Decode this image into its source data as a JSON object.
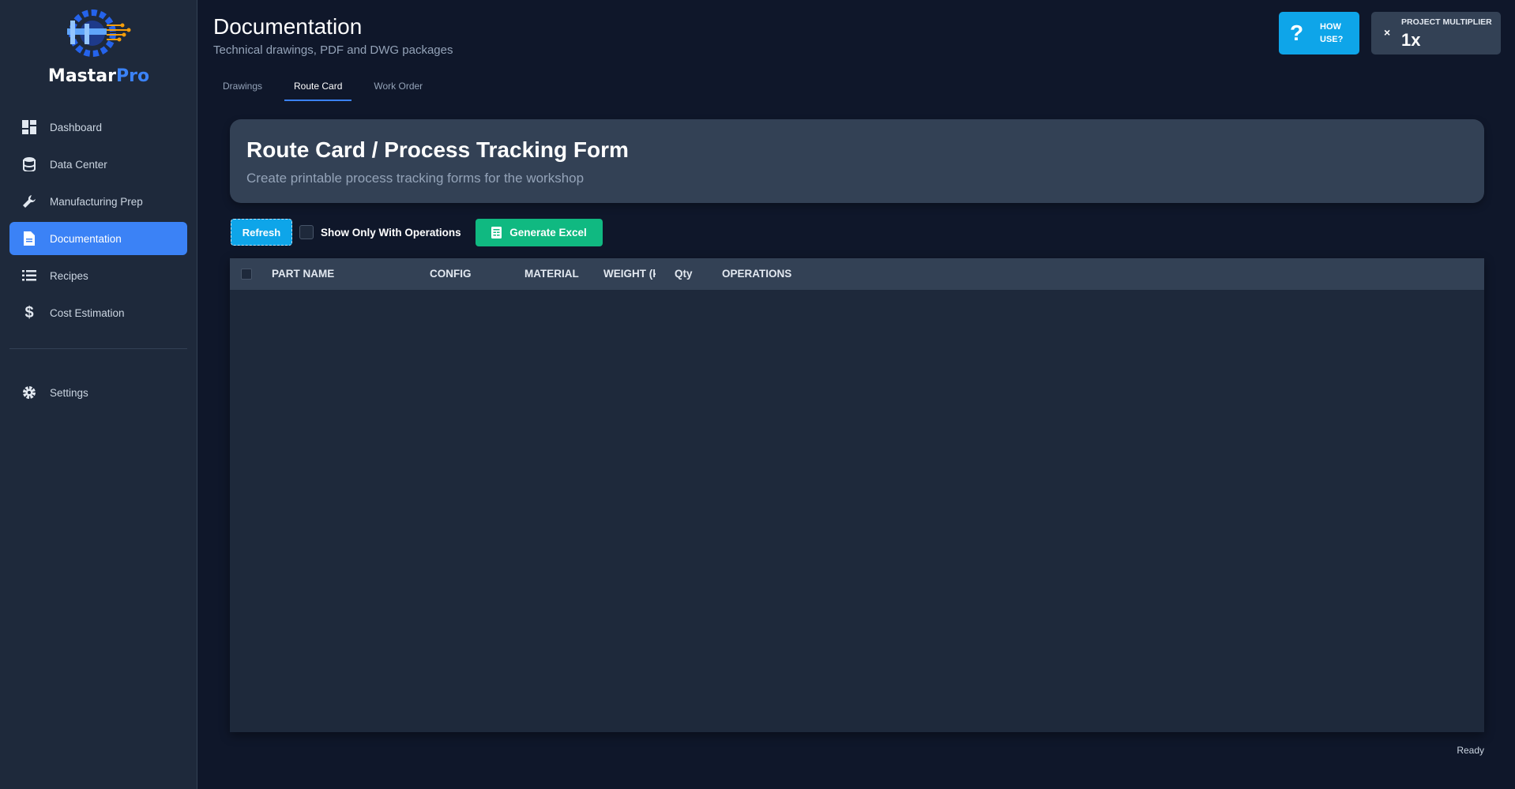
{
  "app": {
    "brand_main": "Mastar",
    "brand_accent": "Pro"
  },
  "sidebar": {
    "items": [
      {
        "label": "Dashboard",
        "icon": "dashboard-icon"
      },
      {
        "label": "Data Center",
        "icon": "database-icon"
      },
      {
        "label": "Manufacturing Prep",
        "icon": "wrench-icon"
      },
      {
        "label": "Documentation",
        "icon": "document-icon",
        "active": true
      },
      {
        "label": "Recipes",
        "icon": "list-icon"
      },
      {
        "label": "Cost Estimation",
        "icon": "dollar-icon"
      }
    ],
    "settings_label": "Settings"
  },
  "header": {
    "title": "Documentation",
    "subtitle": "Technical drawings, PDF and DWG packages",
    "how_label_1": "HOW",
    "how_label_2": "USE?",
    "how_glyph": "?",
    "multiplier_label": "PROJECT MULTIPLIER",
    "multiplier_value": "1x",
    "multiplier_glyph": "×"
  },
  "tabs": [
    {
      "label": "Drawings"
    },
    {
      "label": "Route Card",
      "active": true
    },
    {
      "label": "Work Order"
    }
  ],
  "hero": {
    "title": "Route Card / Process Tracking Form",
    "subtitle": "Create printable process tracking forms for the workshop"
  },
  "toolbar": {
    "refresh_label": "Refresh",
    "filter_label": "Show Only With Operations",
    "filter_checked": false,
    "excel_label": "Generate Excel"
  },
  "table": {
    "columns": [
      "PART NAME",
      "CONFIG",
      "MATERIAL",
      "WEIGHT (k",
      "Qty",
      "OPERATIONS"
    ],
    "rows": []
  },
  "status": "Ready",
  "colors": {
    "accent": "#3b82f6",
    "info": "#0ea5e9",
    "success": "#10b981",
    "background": "#0f172a",
    "panel": "#1e293b"
  }
}
